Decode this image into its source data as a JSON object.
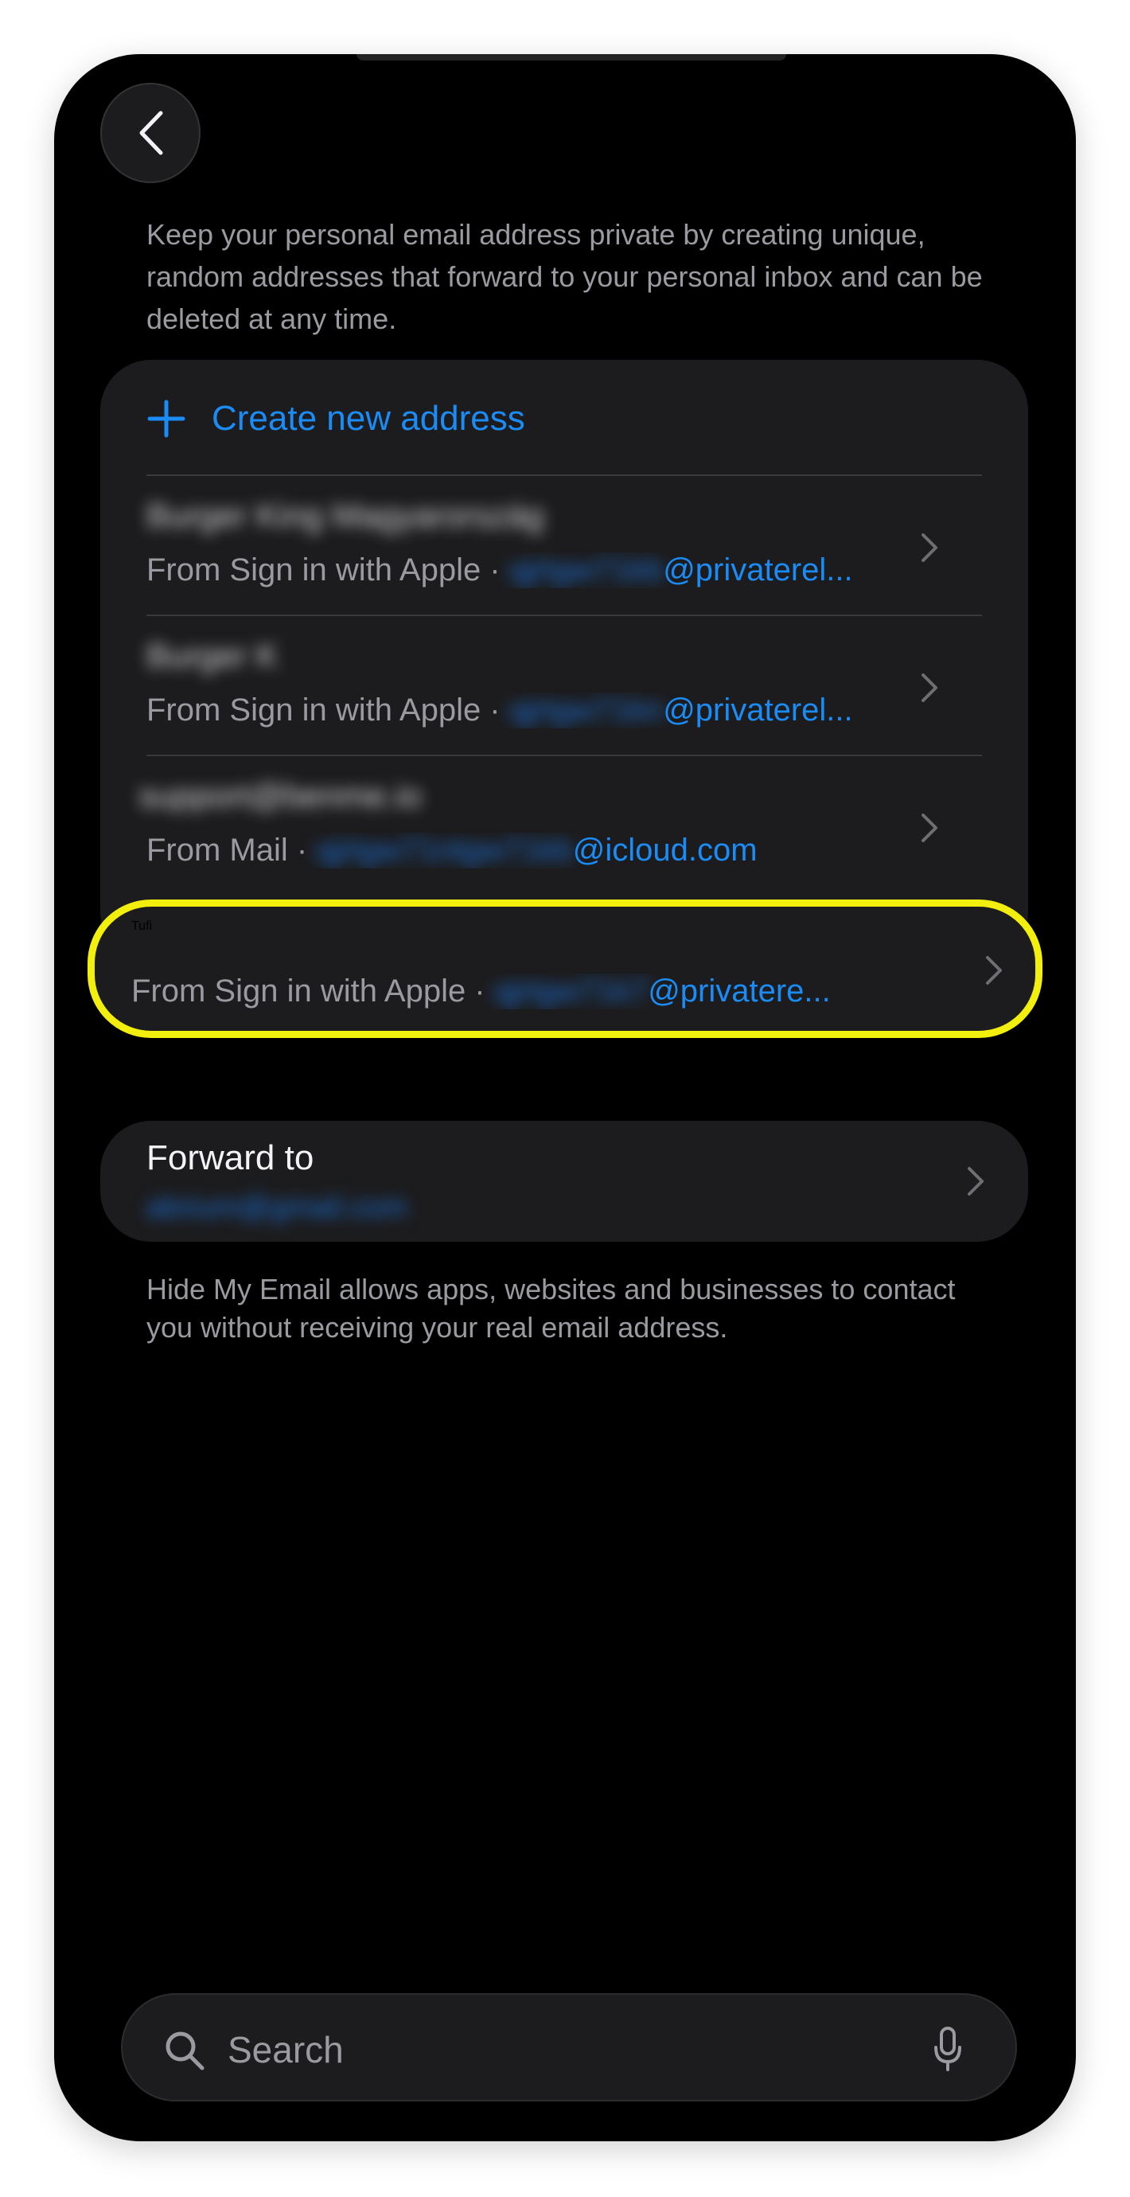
{
  "header": {
    "back_icon": "chevron-left-icon",
    "intro_text": "Keep your personal email address private by creating unique, random addresses that forward to your personal inbox and can be deleted at any time."
  },
  "addresses": {
    "create_label": "Create new address",
    "create_icon": "plus-icon",
    "items": [
      {
        "title": "Burger King Magyarország",
        "source": "From Sign in with Apple · ",
        "email_local": "qjrtgw71kb",
        "email_domain": "@privaterel..."
      },
      {
        "title": "Burger K",
        "source": "From Sign in with Apple · ",
        "email_local": "qjrtgw71kn",
        "email_domain": "@privaterel..."
      },
      {
        "title": "support@benme.io",
        "source": "From Mail · ",
        "email_local": "qjrtgw71ntgw71kb",
        "email_domain": "@icloud.com"
      },
      {
        "title": "Tufi",
        "source": "From Sign in with Apple · ",
        "email_local": "qjrtgw71k7",
        "email_domain": "@privatere...",
        "highlighted": true
      }
    ]
  },
  "forward": {
    "label": "Forward to",
    "value": "abrium@gmail.com"
  },
  "footnote": "Hide My Email allows apps, websites and businesses to contact you without receiving your real email address.",
  "search": {
    "placeholder": "Search",
    "search_icon": "magnifier-icon",
    "mic_icon": "microphone-icon"
  },
  "colors": {
    "accent": "#1b8cf5",
    "highlight": "#f2ee0e",
    "background": "#000000",
    "card": "#1c1c1e"
  }
}
